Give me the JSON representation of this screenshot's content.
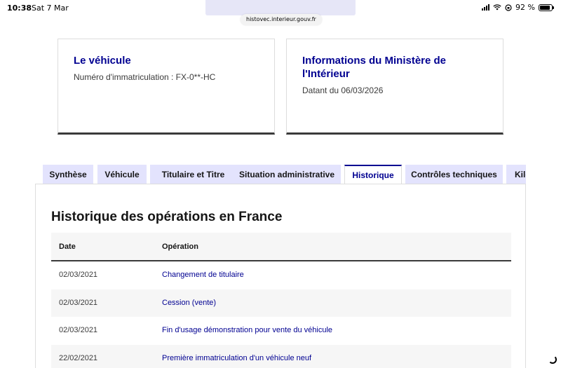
{
  "status_bar": {
    "time": "10:38",
    "date": "Sat 7 Mar",
    "battery": "92 %"
  },
  "browser": {
    "url": "histovec.interieur.gouv.fr"
  },
  "vehicle_card": {
    "title": "Le véhicule",
    "registration": "Numéro d'immatriculation : FX-0**-HC"
  },
  "ministry_card": {
    "title": "Informations du Ministère de l'Intérieur",
    "date": "Datant du 06/03/2026"
  },
  "tabs": [
    {
      "label": "Synthèse"
    },
    {
      "label": "Véhicule"
    },
    {
      "label": "Titulaire et Titre"
    },
    {
      "label": "Situation administrative"
    },
    {
      "label": "Historique"
    },
    {
      "label": "Contrôles techniques"
    },
    {
      "label": "Kilométrage"
    }
  ],
  "history": {
    "title": "Historique des opérations en France",
    "columns": {
      "date": "Date",
      "operation": "Opération"
    },
    "rows": [
      {
        "date": "02/03/2021",
        "operation": "Changement de titulaire"
      },
      {
        "date": "02/03/2021",
        "operation": "Cession (vente)"
      },
      {
        "date": "02/03/2021",
        "operation": "Fin d'usage démonstration pour vente du véhicule"
      },
      {
        "date": "22/02/2021",
        "operation": "Première immatriculation d'un véhicule neuf"
      }
    ]
  },
  "colors": {
    "accent": "#000091",
    "tab_background": "#e3e3fd"
  }
}
